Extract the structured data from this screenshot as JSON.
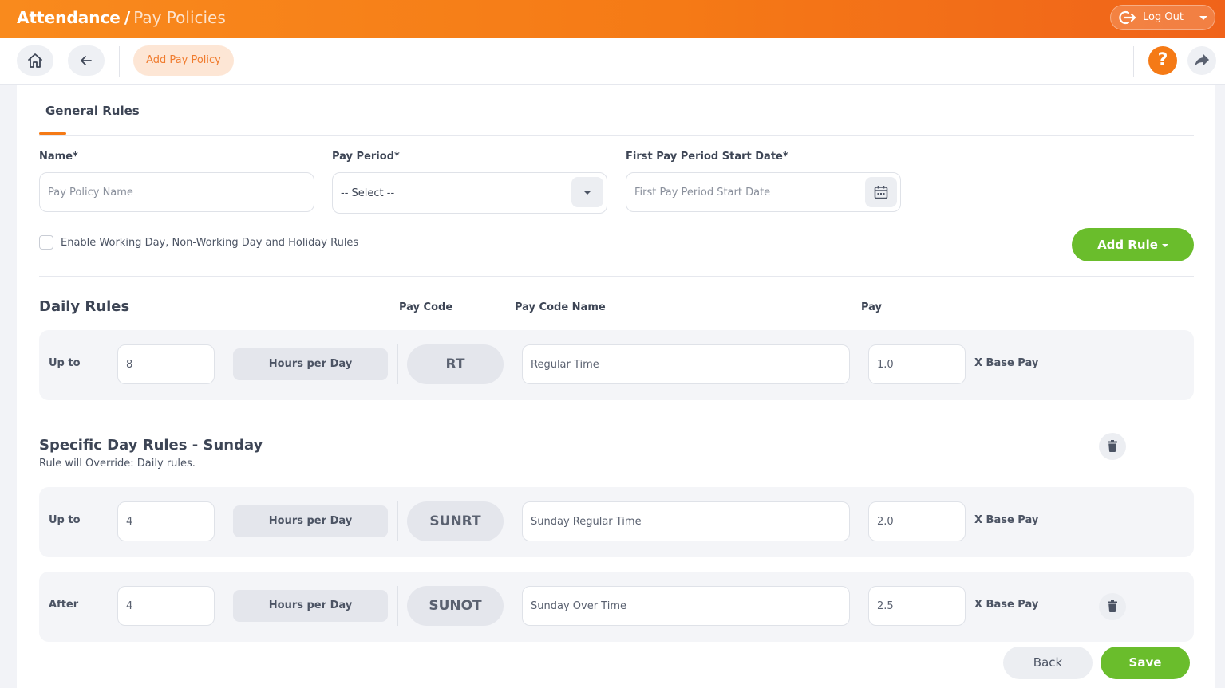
{
  "app": {
    "title_main": "Attendance",
    "title_sep": "/",
    "title_sub": "Pay Policies",
    "logout_label": "Log Out"
  },
  "toolbar": {
    "active_tab": "Add Pay Policy",
    "help_label": "?"
  },
  "form": {
    "tab": "General Rules",
    "name": {
      "label": "Name*",
      "placeholder": "Pay Policy Name"
    },
    "pay_period": {
      "label": "Pay Period*",
      "value": "-- Select --"
    },
    "start_date": {
      "label": "First Pay Period Start Date*",
      "placeholder": "First Pay Period Start Date"
    },
    "enable_rules_label": "Enable Working Day, Non-Working Day and Holiday Rules",
    "enable_rules_checked": false,
    "add_rule_label": "Add Rule"
  },
  "daily_rules": {
    "title": "Daily Rules",
    "columns": {
      "pay_code": "Pay Code",
      "pay_code_name": "Pay Code Name",
      "pay": "Pay"
    },
    "rows": [
      {
        "condition": "Up to",
        "hours": "8",
        "unit": "Hours per Day",
        "code": "RT",
        "code_name": "Regular Time",
        "pay": "1.0",
        "pay_suffix": "X Base Pay"
      }
    ]
  },
  "specific_rules": {
    "title": "Specific Day Rules - Sunday",
    "note": "Rule will Override: Daily rules.",
    "rows": [
      {
        "condition": "Up to",
        "hours": "4",
        "unit": "Hours per Day",
        "code": "SUNRT",
        "code_name": "Sunday Regular Time",
        "pay": "2.0",
        "pay_suffix": "X Base Pay"
      },
      {
        "condition": "After",
        "hours": "4",
        "unit": "Hours per Day",
        "code": "SUNOT",
        "code_name": "Sunday Over Time",
        "pay": "2.5",
        "pay_suffix": "X Base Pay"
      }
    ]
  },
  "footer": {
    "back_label": "Back",
    "save_label": "Save"
  },
  "colors": {
    "brand_orange": "#f57a16",
    "accent_green": "#6abd2c"
  }
}
